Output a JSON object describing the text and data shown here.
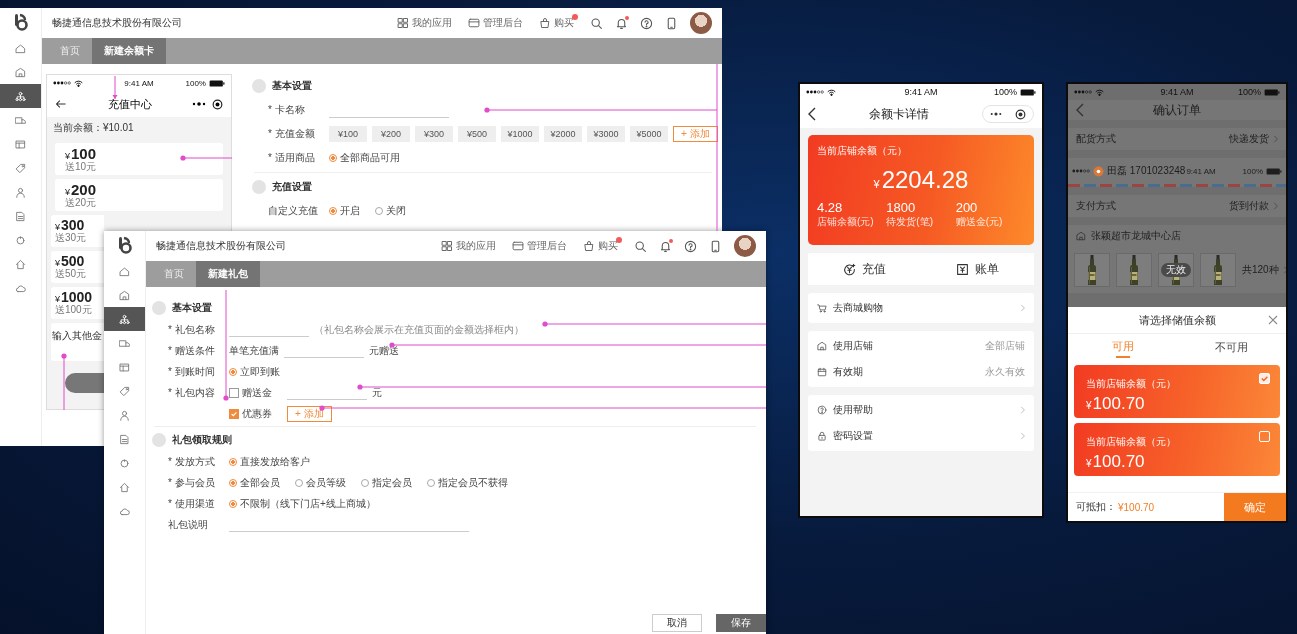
{
  "card_admin": {
    "company": "畅捷通信息技术股份有限公司",
    "header_links": [
      {
        "kind": "apps",
        "label": "我的应用",
        "badge": false
      },
      {
        "kind": "admin",
        "label": "管理后台",
        "badge": false
      },
      {
        "kind": "bag",
        "label": "购买",
        "badge": true
      }
    ],
    "header_icons": [
      {
        "kind": "search",
        "dot": false
      },
      {
        "kind": "bell",
        "dot": true
      },
      {
        "kind": "help",
        "dot": false
      },
      {
        "kind": "phone",
        "dot": false
      }
    ],
    "sidebar": [
      {
        "kind": "home",
        "selected": false
      },
      {
        "kind": "store",
        "selected": false
      },
      {
        "kind": "org",
        "selected": true
      },
      {
        "kind": "truck",
        "selected": false
      },
      {
        "kind": "layout",
        "selected": false
      },
      {
        "kind": "tag",
        "selected": false
      },
      {
        "kind": "user",
        "selected": false
      },
      {
        "kind": "doc",
        "selected": false
      },
      {
        "kind": "ring",
        "selected": false
      },
      {
        "kind": "house",
        "selected": false
      },
      {
        "kind": "cloud",
        "selected": false
      }
    ],
    "tabs": [
      {
        "label": "首页",
        "selected": false
      },
      {
        "label": "新建余额卡",
        "selected": true
      }
    ],
    "preview": {
      "time": "9:41 AM",
      "battery": "100%",
      "title": "充值中心",
      "balance": "当前余额：¥10.01",
      "options": [
        {
          "currency": "¥",
          "amount": "100",
          "bonus": "送10元"
        },
        {
          "currency": "¥",
          "amount": "200",
          "bonus": "送20元"
        },
        {
          "currency": "¥",
          "amount": "300",
          "bonus": "送30元"
        },
        {
          "currency": "¥",
          "amount": "500",
          "bonus": "送50元"
        },
        {
          "currency": "¥",
          "amount": "1000",
          "bonus": "送100元"
        }
      ],
      "custom_amount": "输入其他金"
    },
    "form": [
      {
        "title": "基本设置",
        "rows": [
          {
            "label": "* 卡名称",
            "parts": [
              {
                "kind": "input"
              }
            ]
          },
          {
            "label": "* 充值金额",
            "parts": [
              {
                "kind": "chip",
                "text": "¥100"
              },
              {
                "kind": "chip",
                "text": "¥200"
              },
              {
                "kind": "chip",
                "text": "¥300"
              },
              {
                "kind": "chip",
                "text": "¥500"
              },
              {
                "kind": "chip",
                "text": "¥1000"
              },
              {
                "kind": "chip",
                "text": "¥2000"
              },
              {
                "kind": "chip",
                "text": "¥3000"
              },
              {
                "kind": "chip",
                "text": "¥5000"
              },
              {
                "kind": "add",
                "text": "+ 添加"
              }
            ]
          },
          {
            "label": "* 适用商品",
            "parts": [
              {
                "kind": "radio",
                "text": "全部商品可用",
                "selected": true
              }
            ]
          }
        ]
      },
      {
        "title": "充值设置",
        "rows": [
          {
            "label": "自定义充值",
            "parts": [
              {
                "kind": "radio",
                "text": "开启",
                "selected": true
              },
              {
                "kind": "radio",
                "text": "关闭",
                "selected": false
              }
            ]
          }
        ]
      }
    ]
  },
  "gift_admin": {
    "company": "畅捷通信息技术股份有限公司",
    "header_links": [
      {
        "kind": "apps",
        "label": "我的应用",
        "badge": false
      },
      {
        "kind": "admin",
        "label": "管理后台",
        "badge": false
      },
      {
        "kind": "bag",
        "label": "购买",
        "badge": true
      }
    ],
    "header_icons": [
      {
        "kind": "search",
        "dot": false
      },
      {
        "kind": "bell",
        "dot": true
      },
      {
        "kind": "help",
        "dot": false
      },
      {
        "kind": "phone",
        "dot": false
      }
    ],
    "sidebar": [
      {
        "kind": "home",
        "selected": false
      },
      {
        "kind": "store",
        "selected": false
      },
      {
        "kind": "org",
        "selected": true
      },
      {
        "kind": "truck",
        "selected": false
      },
      {
        "kind": "layout",
        "selected": false
      },
      {
        "kind": "tag",
        "selected": false
      },
      {
        "kind": "user",
        "selected": false
      },
      {
        "kind": "doc",
        "selected": false
      },
      {
        "kind": "ring",
        "selected": false
      },
      {
        "kind": "house",
        "selected": false
      },
      {
        "kind": "cloud",
        "selected": false
      }
    ],
    "tabs": [
      {
        "label": "首页",
        "selected": false
      },
      {
        "label": "新建礼包",
        "selected": true
      }
    ],
    "form": [
      {
        "title": "基本设置",
        "rows": [
          {
            "label": "* 礼包名称",
            "parts": [
              {
                "kind": "input"
              },
              {
                "kind": "note",
                "text": "（礼包名称会展示在充值页面的金额选择框内）"
              }
            ]
          },
          {
            "label": "* 赠送条件",
            "parts": [
              {
                "kind": "text",
                "text": "单笔充值满"
              },
              {
                "kind": "input"
              },
              {
                "kind": "text",
                "text": "元赠送"
              }
            ]
          },
          {
            "label": "* 到账时间",
            "parts": [
              {
                "kind": "radio",
                "text": "立即到账",
                "selected": true
              }
            ]
          },
          {
            "label": "* 礼包内容",
            "parts": [
              {
                "kind": "checkbox",
                "text": "赠送金",
                "checked": false
              },
              {
                "kind": "input"
              },
              {
                "kind": "text",
                "text": "元"
              }
            ]
          },
          {
            "parts": [
              {
                "kind": "checkbox",
                "text": "优惠券",
                "checked": true
              },
              {
                "kind": "add",
                "text": "+ 添加"
              }
            ]
          }
        ]
      },
      {
        "title": "礼包领取规则",
        "rows": [
          {
            "label": "* 发放方式",
            "parts": [
              {
                "kind": "radio",
                "text": "直接发放给客户",
                "selected": true
              }
            ]
          },
          {
            "label": "* 参与会员",
            "parts": [
              {
                "kind": "radio",
                "text": "全部会员",
                "selected": true
              },
              {
                "kind": "radio",
                "text": "会员等级",
                "selected": false
              },
              {
                "kind": "radio",
                "text": "指定会员",
                "selected": false
              },
              {
                "kind": "radio",
                "text": "指定会员不获得",
                "selected": false
              }
            ]
          },
          {
            "label": "* 使用渠道",
            "parts": [
              {
                "kind": "radio",
                "text": "不限制（线下门店+线上商城）",
                "selected": true
              }
            ]
          },
          {
            "label": "礼包说明",
            "parts": [
              {
                "kind": "long_input"
              }
            ]
          }
        ]
      }
    ],
    "footer_buttons": [
      {
        "kind": "secondary",
        "label": "取消"
      },
      {
        "kind": "primary",
        "label": "保存"
      }
    ]
  },
  "balance_card_detail": {
    "time": "9:41 AM",
    "battery": "100%",
    "title": "余额卡详情",
    "card": {
      "title": "当前店铺余额（元）",
      "currency": "¥",
      "amount": "2204.28",
      "stats": [
        {
          "value": "4.28",
          "label": "店铺余额(元)"
        },
        {
          "value": "1800",
          "label": "待发货(笔)"
        },
        {
          "value": "200",
          "label": "赠送金(元)"
        }
      ]
    },
    "actions": [
      {
        "kind": "coin",
        "label": "充值"
      },
      {
        "kind": "bill",
        "label": "账单"
      }
    ],
    "groups": [
      [
        {
          "kind": "cart",
          "label": "去商城购物",
          "chevron": true
        }
      ],
      [
        {
          "kind": "store",
          "label": "使用店铺",
          "value": "全部店铺"
        },
        {
          "kind": "calendar",
          "label": "有效期",
          "value": "永久有效"
        }
      ],
      [
        {
          "kind": "help",
          "label": "使用帮助",
          "chevron": true
        },
        {
          "kind": "lock",
          "label": "密码设置",
          "chevron": true
        }
      ]
    ]
  },
  "confirm_order": {
    "time": "9:41 AM",
    "battery": "100%",
    "title": "确认订单",
    "delivery": {
      "label": "配货方式",
      "value": "快递发货"
    },
    "address": {
      "name": "田磊 1701023248",
      "time": "9:41 AM",
      "battery": "100%"
    },
    "payment": {
      "label": "支付方式",
      "value": "货到付款"
    },
    "store": "张颖超市龙城中心店",
    "products": [
      {
        "kind": "picture",
        "invalid": false
      },
      {
        "kind": "picture",
        "invalid": false
      },
      {
        "kind": "picture",
        "invalid": true,
        "badge": "无效"
      },
      {
        "kind": "picture",
        "invalid": false
      }
    ],
    "product_count": "共120种",
    "sheet": {
      "title": "请选择储值余额",
      "tabs": [
        {
          "label": "可用",
          "selected": true
        },
        {
          "label": "不可用",
          "selected": false
        }
      ],
      "cards": [
        {
          "title": "当前店铺余额（元）",
          "currency": "¥",
          "amount": "100.70",
          "checked": true
        },
        {
          "title": "当前店铺余额（元）",
          "currency": "¥",
          "amount": "100.70",
          "checked": false
        }
      ],
      "deduct_label": "可抵扣：",
      "deduct_amount": "¥100.70",
      "confirm": "确定"
    }
  }
}
